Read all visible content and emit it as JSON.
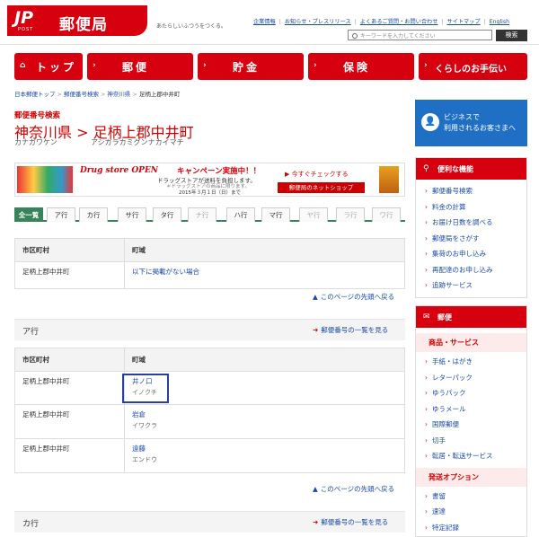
{
  "header": {
    "logo_mark": "JP",
    "logo_post": "POST",
    "logo_name": "郵便局",
    "tagline": "あたらしいふつうをつくる。",
    "links": [
      "企業情報",
      "お知らせ・プレスリリース",
      "よくあるご質問・お問い合わせ",
      "サイトマップ",
      "English"
    ],
    "search_placeholder": "キーワードを入力してください",
    "search_button": "検索"
  },
  "nav": [
    {
      "label": "トップ",
      "icon": "home-icon"
    },
    {
      "label": "郵便",
      "icon": "chevron-right-icon"
    },
    {
      "label": "貯金",
      "icon": "chevron-right-icon"
    },
    {
      "label": "保険",
      "icon": "chevron-right-icon"
    },
    {
      "label": "くらしのお手伝い",
      "icon": "chevron-right-icon"
    }
  ],
  "breadcrumb": [
    "日本郵便トップ",
    "郵便番号検索",
    "神奈川県",
    "足柄上郡中井町"
  ],
  "page": {
    "category": "郵便番号検索",
    "title_pref": "神奈川県",
    "title_sep": ">",
    "title_city": "足柄上郡中井町",
    "kana_pref": "カナガワケン",
    "kana_city": "アシガラカミグンナカイマチ"
  },
  "banner": {
    "brand": "Drug store OPEN",
    "campaign": "キャンペーン実施中！！",
    "line1": "ドラッグストアが送料を負担します。",
    "line2": "＊ドラッグストアの商品に限ります。",
    "line3": "2015年３月１日（日）まで",
    "check": "今すぐチェックする",
    "shop": "郵便局のネットショップ"
  },
  "tabs": [
    {
      "label": "全一覧",
      "state": "active"
    },
    {
      "label": "ア行",
      "state": "normal"
    },
    {
      "label": "カ行",
      "state": "normal"
    },
    {
      "label": "サ行",
      "state": "normal"
    },
    {
      "label": "タ行",
      "state": "normal"
    },
    {
      "label": "ナ行",
      "state": "disabled"
    },
    {
      "label": "ハ行",
      "state": "normal"
    },
    {
      "label": "マ行",
      "state": "normal"
    },
    {
      "label": "ヤ行",
      "state": "disabled"
    },
    {
      "label": "ラ行",
      "state": "disabled"
    },
    {
      "label": "ワ行",
      "state": "disabled"
    }
  ],
  "table_headers": {
    "city": "市区町村",
    "town": "町域"
  },
  "table1": [
    {
      "city": "足柄上郡中井町",
      "town": "以下に掲載がない場合"
    }
  ],
  "back_to_top": "このページの先頭へ戻る",
  "section_a": {
    "title": "ア行",
    "link": "郵便番号の一覧を見る"
  },
  "table2": [
    {
      "city": "足柄上郡中井町",
      "town": "井ノ口",
      "kana": "イノクチ"
    },
    {
      "city": "足柄上郡中井町",
      "town": "岩倉",
      "kana": "イワクラ"
    },
    {
      "city": "足柄上郡中井町",
      "town": "遠藤",
      "kana": "エンドウ"
    }
  ],
  "section_ka": {
    "title": "カ行",
    "link": "郵便番号の一覧を見る"
  },
  "sidebar": {
    "business_line1": "ビジネスで",
    "business_line2": "利用されるお客さまへ",
    "tools_title": "便利な機能",
    "tools": [
      "郵便番号検索",
      "料金の計算",
      "お届け日数を調べる",
      "郵便局をさがす",
      "集荷のお申し込み",
      "再配達のお申し込み",
      "追跡サービス"
    ],
    "mail_title": "郵便",
    "products_title": "商品・サービス",
    "products": [
      "手紙・はがき",
      "レターパック",
      "ゆうパック",
      "ゆうメール",
      "国際郵便",
      "切手",
      "転居・転送サービス"
    ],
    "options_title": "発送オプション",
    "options": [
      "書留",
      "速達",
      "特定記録"
    ]
  },
  "colors": {
    "brand_red": "#d7000f",
    "tab_green": "#37845a",
    "business_blue": "#1f6fc4",
    "highlight_border": "#2a3fa0"
  }
}
